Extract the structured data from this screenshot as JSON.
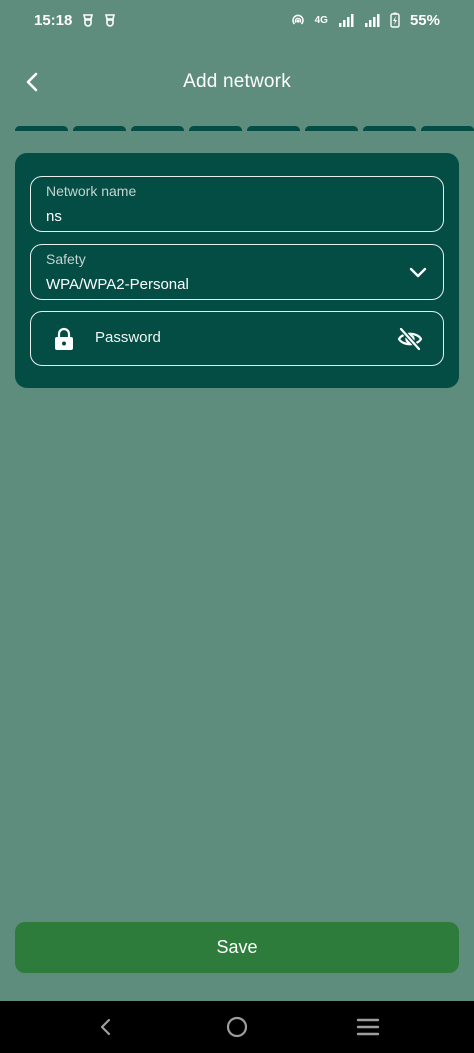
{
  "status_bar": {
    "time": "15:18",
    "network_type": "4G",
    "battery_percent": "55%"
  },
  "header": {
    "title": "Add network",
    "back_icon": "chevron-left-icon"
  },
  "progress": {
    "segments": 8
  },
  "form": {
    "network_name": {
      "label": "Network name",
      "value": "ns"
    },
    "safety": {
      "label": "Safety",
      "value": "WPA/WPA2-Personal"
    },
    "password": {
      "placeholder": "Password",
      "value": ""
    }
  },
  "actions": {
    "save_label": "Save"
  },
  "colors": {
    "background": "#5e8d7e",
    "card": "#044d45",
    "accent_button": "#2e7c3b",
    "text": "#ffffff"
  }
}
